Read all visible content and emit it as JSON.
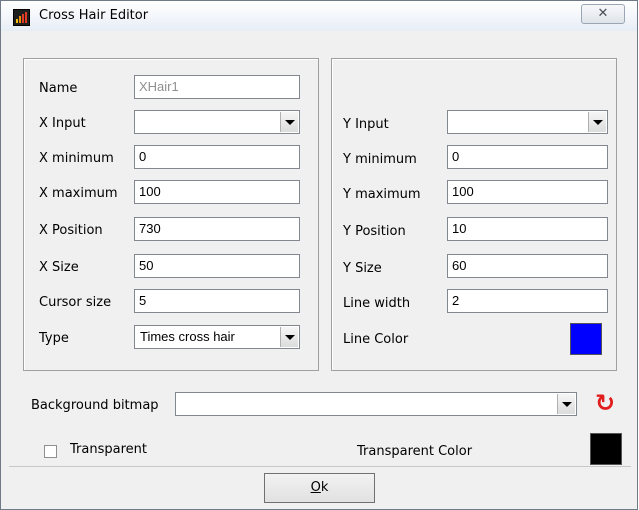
{
  "window": {
    "title": "Cross Hair Editor",
    "close_glyph": "✕"
  },
  "left_panel": {
    "name_label": "Name",
    "name_value": "XHair1",
    "x_input_label": "X Input",
    "x_input_value": "",
    "x_min_label": "X minimum",
    "x_min_value": "0",
    "x_max_label": "X maximum",
    "x_max_value": "100",
    "x_pos_label": "X Position",
    "x_pos_value": "730",
    "x_size_label": "X Size",
    "x_size_value": "50",
    "cursor_size_label": "Cursor size",
    "cursor_size_value": "5",
    "type_label": "Type",
    "type_value": "Times cross hair"
  },
  "right_panel": {
    "y_input_label": "Y Input",
    "y_input_value": "",
    "y_min_label": "Y minimum",
    "y_min_value": "0",
    "y_max_label": "Y maximum",
    "y_max_value": "100",
    "y_pos_label": "Y Position",
    "y_pos_value": "10",
    "y_size_label": "Y Size",
    "y_size_value": "60",
    "line_width_label": "Line width",
    "line_width_value": "2",
    "line_color_label": "Line Color",
    "line_color": "#0000ff"
  },
  "background": {
    "label": "Background bitmap",
    "value": ""
  },
  "transparent": {
    "label": "Transparent",
    "checked": false,
    "color_label": "Transparent Color",
    "color": "#000000"
  },
  "ok_button": {
    "hotkey": "O",
    "rest": "k"
  }
}
